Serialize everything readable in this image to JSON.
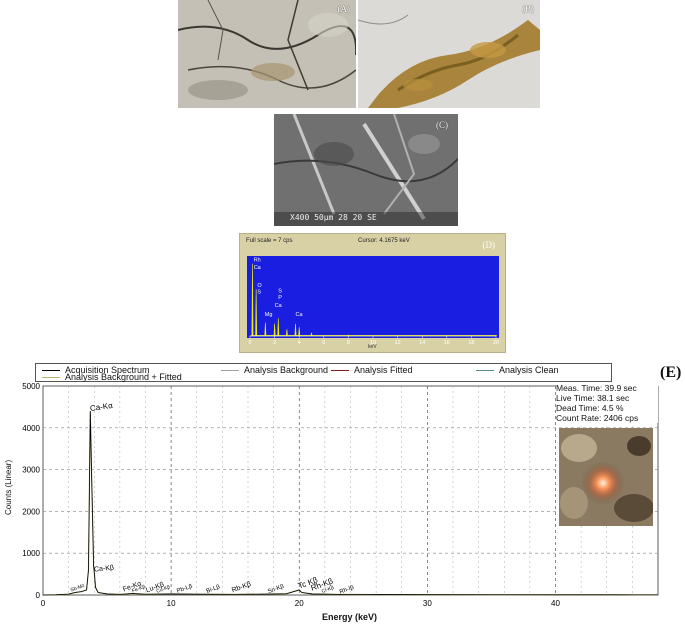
{
  "panels": {
    "a_label": "(A)",
    "b_label": "(B)",
    "c_label": "(C)",
    "c_scale_text": "X400  50µm   28 20 SE",
    "d_label": "(D)",
    "e_label": "(E)"
  },
  "panel_d": {
    "full_scale": "Full scale = 7  cps",
    "cursor": "Cursor:  4.1675 keV",
    "x_ticks": [
      "0",
      "2",
      "4",
      "6",
      "8",
      "10",
      "12",
      "14",
      "16",
      "18",
      "20"
    ],
    "x_unit": "keV",
    "peak_labels": [
      "Rh",
      "Ca",
      "O",
      "S",
      "Mg",
      "S",
      "P",
      "Ca",
      "Ca"
    ]
  },
  "panel_e": {
    "legend": {
      "acquisition": "Acquisition Spectrum",
      "background": "Analysis Background",
      "fitted": "Analysis Fitted",
      "clean": "Analysis Clean",
      "bg_fitted": "Analysis Background + Fitted"
    },
    "legend_colors": {
      "acquisition": "#000000",
      "background": "#a0a0a0",
      "fitted": "#8b1a1a",
      "clean": "#5a8a8a",
      "bg_fitted": "#b8b070"
    },
    "measurement": {
      "meas_time": "Meas. Time: 39.9 sec",
      "live_time": "Live Time: 38.1 sec",
      "dead_time": "Dead Time: 4.5 %",
      "count_rate": "Count Rate: 2406 cps"
    },
    "ylabel": "Counts (Linear)",
    "xlabel": "Energy (keV)",
    "y_ticks": [
      "0",
      "1000",
      "2000",
      "3000",
      "4000",
      "5000"
    ],
    "x_ticks": [
      "0",
      "10",
      "20",
      "30",
      "40"
    ],
    "peak_labels": {
      "ca_ka": "Ca-Kα",
      "ca_kb": "Ca-Kβ",
      "sb_mz": "Sb-Mz",
      "fe_ka": "Fe-Kα",
      "fe_kb": "Fe-Kβ",
      "lu_kb": "Lu-Kβ",
      "cu_kb": "Cu-Kβ",
      "pb_lb": "Pb-Lβ",
      "bi_lb": "Bi-Lβ",
      "rb_kb": "Rb-Kβ",
      "sn_kb": "Sn-Kβ",
      "tc_kb": "Tc Kβ",
      "rh_kb": "Rh-Kβ",
      "cl_kb": "Cl-Kβ",
      "rh_lb": "Rh-Iβ"
    }
  },
  "chart_data": [
    {
      "type": "line",
      "title": "",
      "xlabel": "keV",
      "ylabel": "",
      "xlim": [
        0,
        20
      ],
      "x_ticks": [
        0,
        2,
        4,
        6,
        8,
        10,
        12,
        14,
        16,
        18,
        20
      ],
      "series": [
        {
          "x": [
            0.2,
            0.5,
            1.25,
            2.0,
            2.3,
            3.0,
            3.7,
            4.0,
            5.0,
            8.0,
            20.0
          ],
          "values": [
            6.5,
            4.2,
            1.2,
            1.1,
            1.6,
            0.6,
            1.1,
            0.8,
            0.3,
            0.1,
            0.05
          ]
        }
      ],
      "annotations": [
        "Rh",
        "Ca",
        "O",
        "S",
        "Mg",
        "S",
        "P",
        "Ca",
        "Ca"
      ]
    },
    {
      "type": "line",
      "title": "",
      "xlabel": "Energy (keV)",
      "ylabel": "Counts (Linear)",
      "xlim": [
        0,
        48
      ],
      "ylim": [
        0,
        5000
      ],
      "x_ticks": [
        0,
        10,
        20,
        30,
        40
      ],
      "y_ticks": [
        0,
        1000,
        2000,
        3000,
        4000,
        5000
      ],
      "grid": true,
      "legend_position": "top",
      "series": [
        {
          "name": "Acquisition Spectrum",
          "x": [
            0,
            1,
            2,
            2.5,
            3,
            3.4,
            3.55,
            3.69,
            3.8,
            3.95,
            4.01,
            4.1,
            4.3,
            5,
            6,
            7,
            8,
            10,
            12,
            15,
            17,
            19,
            20,
            20.2,
            21,
            23,
            25,
            30,
            35,
            40,
            45,
            48
          ],
          "values": [
            0,
            5,
            20,
            60,
            80,
            120,
            600,
            4400,
            2800,
            700,
            520,
            180,
            60,
            25,
            15,
            35,
            18,
            25,
            20,
            15,
            20,
            30,
            120,
            60,
            25,
            15,
            12,
            8,
            6,
            5,
            4,
            3
          ]
        }
      ],
      "annotations": [
        "Ca-Kα",
        "Ca-Kβ",
        "Sb-Mz",
        "Fe-Kα",
        "Fe-Kβ",
        "Lu-Kβ",
        "Cu-Kβ",
        "Pb-Lβ",
        "Bi-Lβ",
        "Rb-Kβ",
        "Sn-Kβ",
        "Tc Kβ",
        "Rh-Kβ",
        "Cl-Kβ",
        "Rh-Iβ"
      ]
    }
  ]
}
